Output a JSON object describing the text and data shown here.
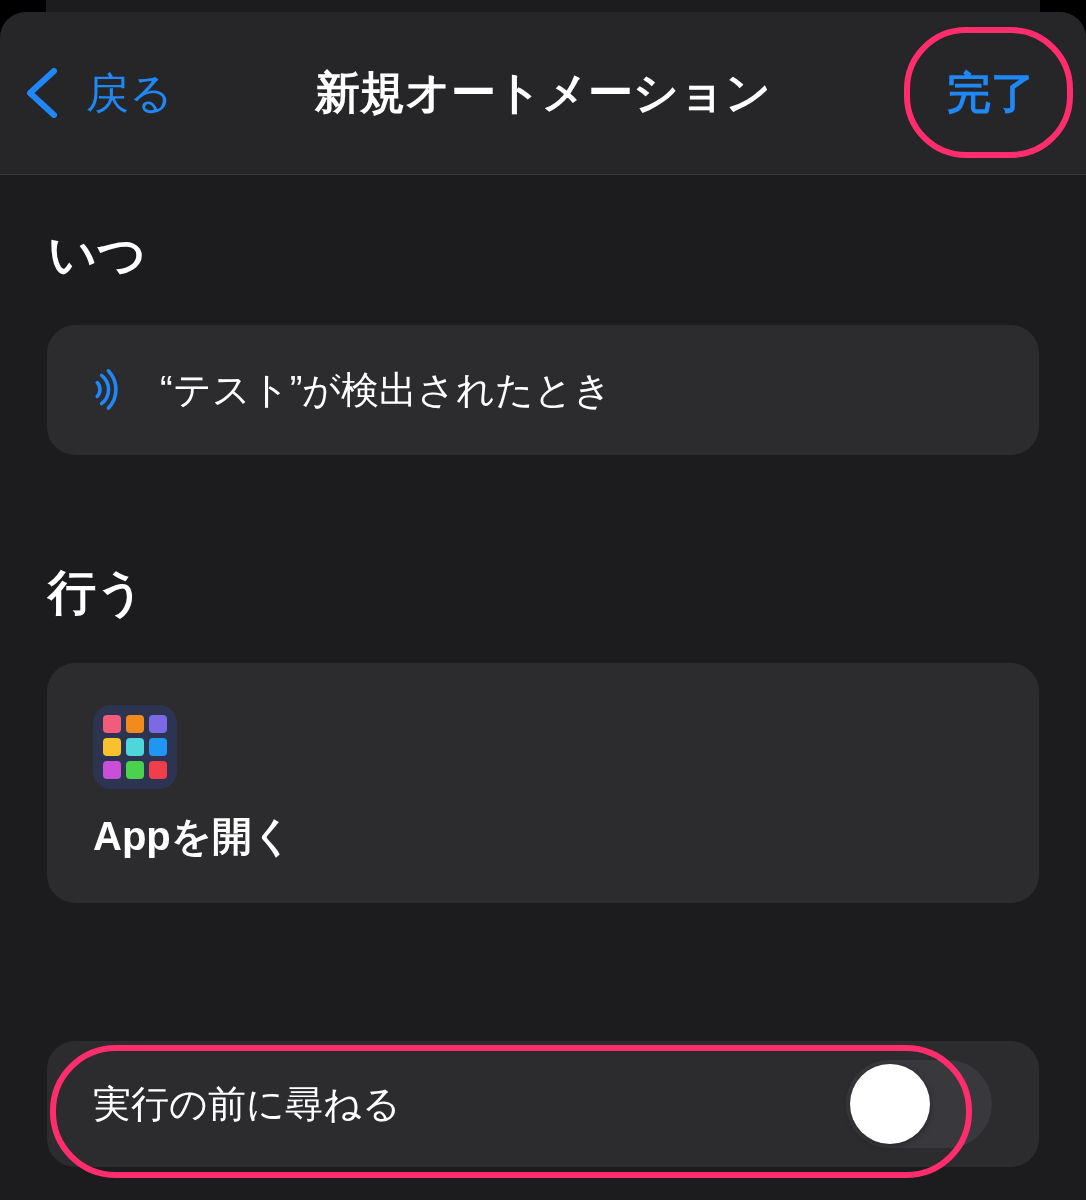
{
  "nav_bar": {
    "back_button": {
      "label": "戻る"
    },
    "title": "新規オートメーション",
    "done_button": {
      "label": "完了",
      "highlighted": true
    }
  },
  "sections": [
    {
      "heading": "いつ",
      "card": {
        "kind": "trigger",
        "text": "“テスト”が検出されたとき"
      }
    },
    {
      "heading": "行う",
      "card": {
        "kind": "action",
        "text": "Appを開く"
      }
    }
  ],
  "setting": {
    "label": "実行の前に尋ねる",
    "on": false,
    "highlighted": true
  }
}
